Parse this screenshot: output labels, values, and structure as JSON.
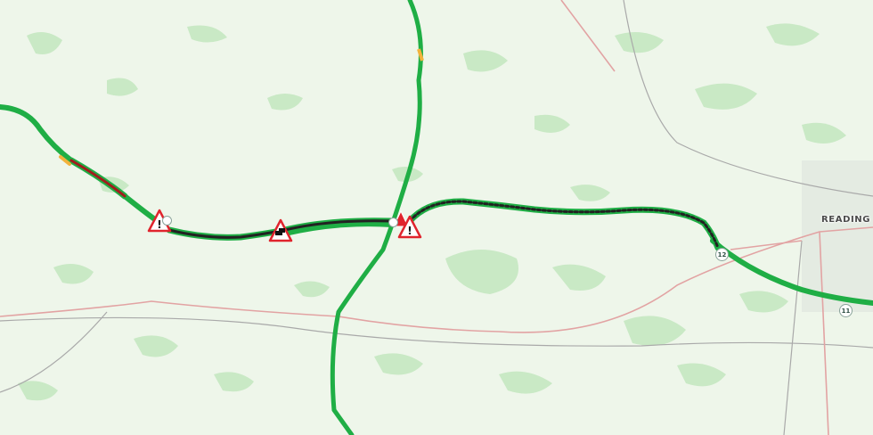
{
  "map": {
    "place_labels": {
      "reading": "READING"
    },
    "junctions": {
      "j12": "12",
      "j11": "11",
      "jw": "",
      "jc": ""
    },
    "colors": {
      "land": "#eef6ea",
      "woodland": "#c9e9c5",
      "traffic_free_flow": "#1fae45",
      "traffic_heavy": "#222222",
      "traffic_severe": "#a11d1d",
      "minor_road": "#e2a3a3",
      "railway": "#a9a9a9",
      "warning_red": "#e0242d"
    },
    "incidents": [
      {
        "name": "incident-warning-west",
        "icon": "warning-triangle-icon"
      },
      {
        "name": "incident-queue",
        "icon": "queue-traffic-icon"
      },
      {
        "name": "incident-roadworks-junction",
        "icon": "roadworks-warning-icon"
      }
    ]
  }
}
